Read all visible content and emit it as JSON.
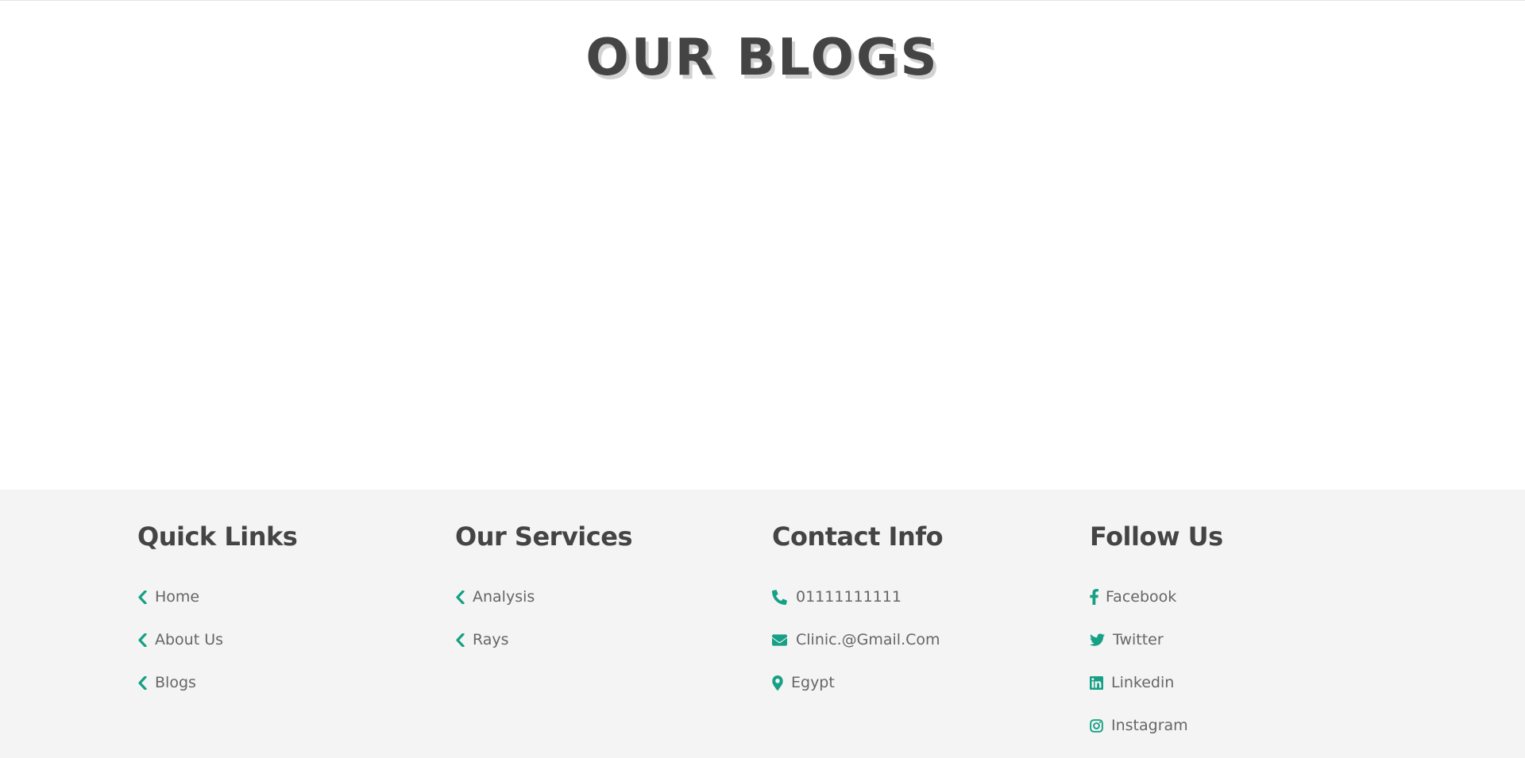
{
  "blogs": {
    "title": "OUR BLOGS"
  },
  "footer": {
    "accent_color": "#16a085",
    "columns": [
      {
        "heading": "Quick Links",
        "items": [
          {
            "label": "Home",
            "icon": "chevron-left-icon"
          },
          {
            "label": "About Us",
            "icon": "chevron-left-icon"
          },
          {
            "label": "Blogs",
            "icon": "chevron-left-icon"
          }
        ]
      },
      {
        "heading": "Our Services",
        "items": [
          {
            "label": "Analysis",
            "icon": "chevron-left-icon"
          },
          {
            "label": "Rays",
            "icon": "chevron-left-icon"
          }
        ]
      },
      {
        "heading": "Contact Info",
        "items": [
          {
            "label": "01111111111",
            "icon": "phone-icon"
          },
          {
            "label": "Clinic.@Gmail.Com",
            "icon": "envelope-icon"
          },
          {
            "label": "Egypt",
            "icon": "map-marker-icon"
          }
        ]
      },
      {
        "heading": "Follow Us",
        "items": [
          {
            "label": "Facebook",
            "icon": "facebook-icon"
          },
          {
            "label": "Twitter",
            "icon": "twitter-icon"
          },
          {
            "label": "Linkedin",
            "icon": "linkedin-icon"
          },
          {
            "label": "Instagram",
            "icon": "instagram-icon"
          }
        ]
      }
    ]
  }
}
